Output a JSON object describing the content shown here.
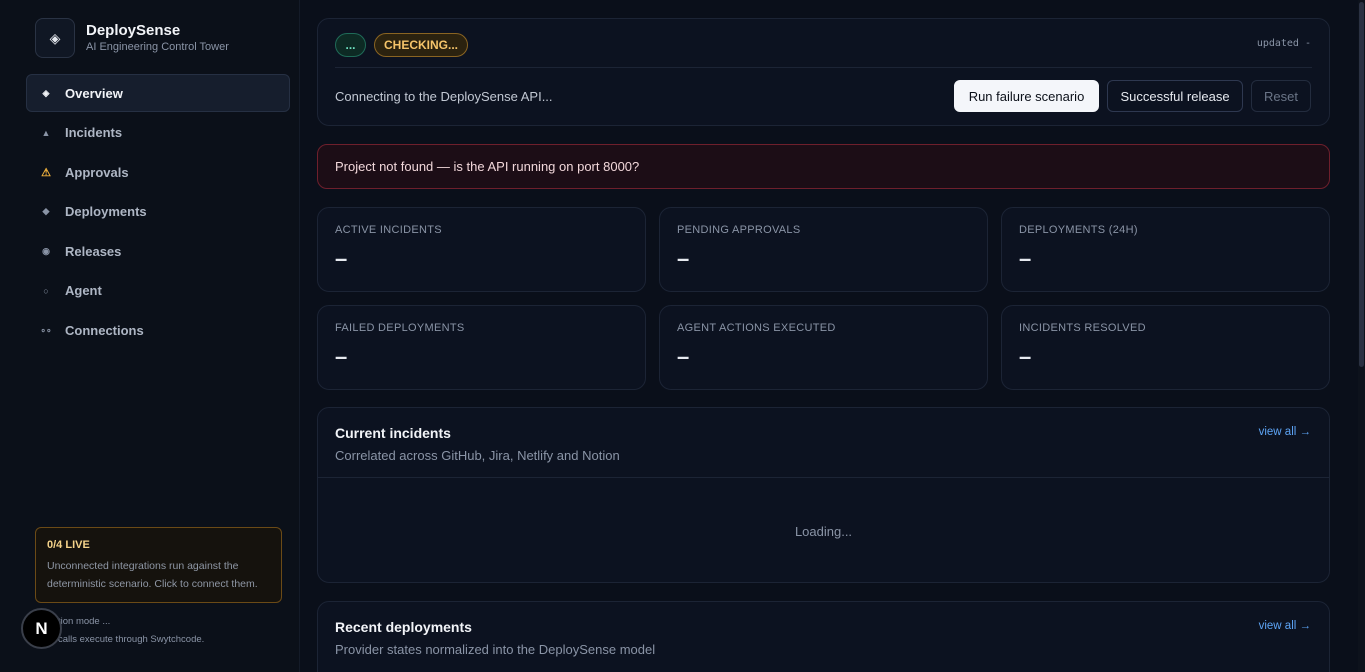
{
  "brand": {
    "name": "DeploySense",
    "subtitle": "AI Engineering Control Tower",
    "logo_icon": "◈"
  },
  "nav": [
    {
      "label": "Overview",
      "icon": "◈",
      "active": true
    },
    {
      "label": "Incidents",
      "icon": "▲"
    },
    {
      "label": "Approvals",
      "icon": "⚠"
    },
    {
      "label": "Deployments",
      "icon": "◆"
    },
    {
      "label": "Releases",
      "icon": "◉"
    },
    {
      "label": "Agent",
      "icon": "○"
    },
    {
      "label": "Connections",
      "icon": "∘∘"
    }
  ],
  "live": {
    "title": "0/4 LIVE",
    "desc": "Unconnected integrations run against the deterministic scenario. Click to connect them."
  },
  "mode": {
    "line1": "tion mode ...",
    "line2": "calls execute through Swytchcode."
  },
  "n_badge": "N",
  "status": {
    "pill_dots": "...",
    "pill_state": "CHECKING...",
    "updated": "updated -",
    "message": "Connecting to the DeploySense API..."
  },
  "actions": {
    "run_failure": "Run failure scenario",
    "successful_release": "Successful release",
    "reset": "Reset"
  },
  "error": "Project not found — is the API running on port 8000?",
  "stats": [
    {
      "label": "ACTIVE INCIDENTS",
      "value": "–"
    },
    {
      "label": "PENDING APPROVALS",
      "value": "–"
    },
    {
      "label": "DEPLOYMENTS (24H)",
      "value": "–"
    },
    {
      "label": "FAILED DEPLOYMENTS",
      "value": "–"
    },
    {
      "label": "AGENT ACTIONS EXECUTED",
      "value": "–"
    },
    {
      "label": "INCIDENTS RESOLVED",
      "value": "–"
    }
  ],
  "incidents": {
    "title": "Current incidents",
    "subtitle": "Correlated across GitHub, Jira, Netlify and Notion",
    "view_all": "view all →",
    "loading": "Loading..."
  },
  "deployments": {
    "title": "Recent deployments",
    "subtitle": "Provider states normalized into the DeploySense model",
    "view_all": "view all →"
  },
  "colors": {
    "background": "#0a0f1a",
    "accent_link": "#5da4f5",
    "warning": "#f2b33d",
    "error_border": "#6e1f2c"
  }
}
